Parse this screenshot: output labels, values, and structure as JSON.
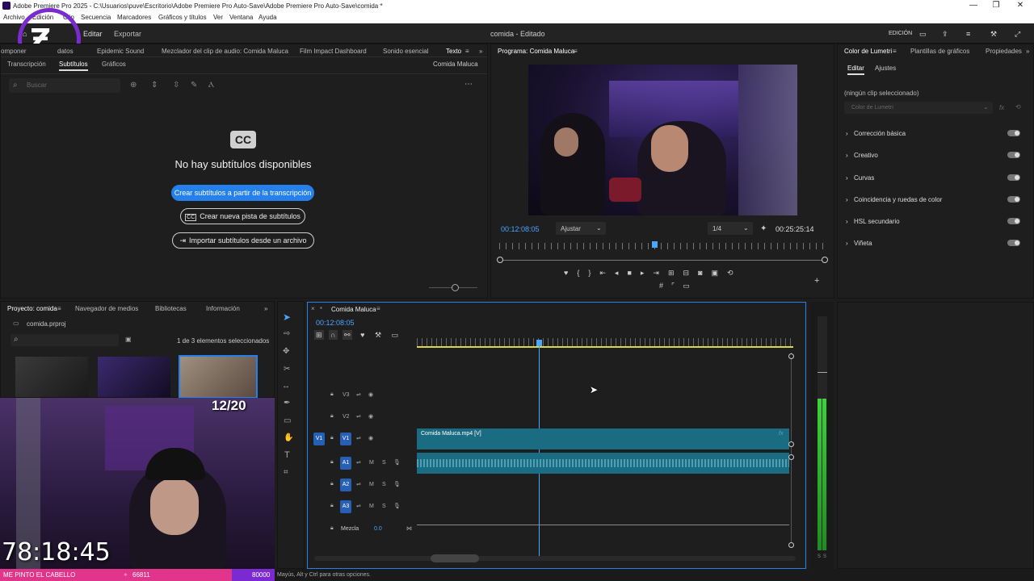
{
  "window": {
    "title": "Adobe Premiere Pro 2025 - C:\\Usuarios\\puve\\Escritorio\\Adobe Premiere Pro Auto-Save\\Adobe Premiere Pro Auto-Save\\comida *"
  },
  "menu": [
    "Archivo",
    "Edición",
    "Clip",
    "Secuencia",
    "Marcadores",
    "Gráficos y títulos",
    "Ver",
    "Ventana",
    "Ayuda"
  ],
  "header": {
    "tabs": [
      "Editar",
      "Exportar"
    ],
    "center": "comida - Editado",
    "workspace": "EDICIÓN"
  },
  "text_panel": {
    "tabs": [
      "omponer",
      "datos",
      "Epidemic Sound",
      "Mezclador del clip de audio: Comida Maluca",
      "Film Impact Dashboard",
      "Sonido esencial",
      "Texto"
    ],
    "subtabs": [
      "Transcripción",
      "Subtítulos",
      "Gráficos"
    ],
    "sequence": "Comida Maluca",
    "search_placeholder": "Buscar",
    "cc": "CC",
    "empty": "No hay subtítulos disponibles",
    "btn_create_from_transcript": "Crear subtítulos a partir de la transcripción",
    "btn_new_track": "Crear nueva pista de subtítulos",
    "btn_import": "Importar subtítulos desde un archivo"
  },
  "program": {
    "tab": "Programa: Comida Maluca",
    "timecode": "00:12:08:05",
    "fit": "Ajustar",
    "res": "1/4",
    "duration": "00:25:25:14"
  },
  "lumetri": {
    "tabs": [
      "Color de Lumetri",
      "Plantillas de gráficos",
      "Propiedades"
    ],
    "subtabs": [
      "Editar",
      "Ajustes"
    ],
    "no_clip": "(ningún clip seleccionado)",
    "dropdown": "Color de Lumetri",
    "sections": [
      "Corrección básica",
      "Creativo",
      "Curvas",
      "Coincidencia y ruedas de color",
      "HSL secundario",
      "Viñeta"
    ]
  },
  "project": {
    "tabs": [
      "Proyecto: comida",
      "Navegador de medios",
      "Bibliotecas",
      "Información"
    ],
    "file": "comida.prproj",
    "count": "1 de 3 elementos seleccionados"
  },
  "timeline": {
    "tab": "Comida Maluca",
    "timecode": "00:12:08:05",
    "tracks_video": [
      "V3",
      "V2",
      "V1"
    ],
    "tracks_audio": [
      "A1",
      "A2",
      "A3"
    ],
    "v1_src": "V1",
    "mix": "Mezcla",
    "mix_val": "0.0",
    "ms": [
      "M",
      "S"
    ],
    "clip": "Comida Maluca.mp4 [V]"
  },
  "meter": {
    "labels": [
      "S",
      "S"
    ]
  },
  "overlay": {
    "counter": "12/20",
    "timer": "78:18:45",
    "bar_text": "ME PINTO EL CABELLO",
    "bar_count": "66811",
    "bar_right": "80000"
  },
  "status": "Mayús, Alt y Ctrl para otras opciones.",
  "colors": {
    "accent": "#2680eb",
    "track": "#1a6c82",
    "purple": "#7a2ad0",
    "pink": "#e0358a"
  }
}
